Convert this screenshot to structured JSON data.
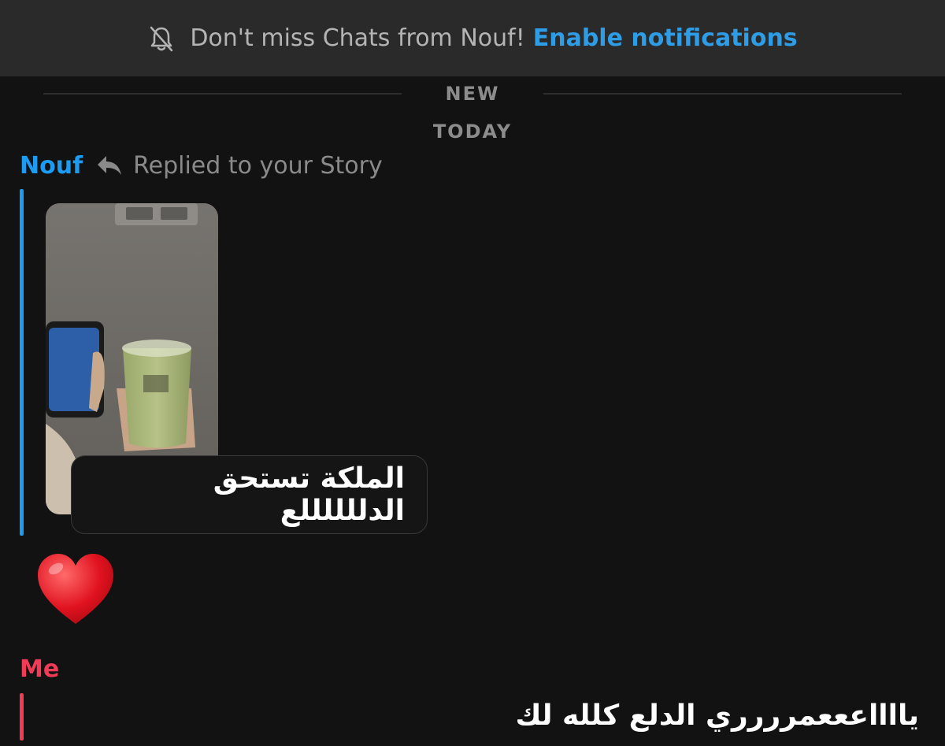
{
  "banner": {
    "text": "Don't miss Chats from Nouf!",
    "cta": "Enable notifications",
    "icon": "bell-off-icon"
  },
  "separators": {
    "new": "NEW",
    "today": "TODAY"
  },
  "messages": [
    {
      "sender": "Nouf",
      "sender_color": "#1d9bf0",
      "reply_label": "Replied to your Story",
      "reply_icon": "reply-arrow-icon",
      "story_thumbnail": "story-image-matcha-drink",
      "caption": "الملكة تستحق الدللللللع",
      "reaction": "heart-emoji"
    },
    {
      "sender": "Me",
      "sender_color": "#f23c57",
      "text": "يااااعععمرررري الدلع كلله لك"
    }
  ]
}
